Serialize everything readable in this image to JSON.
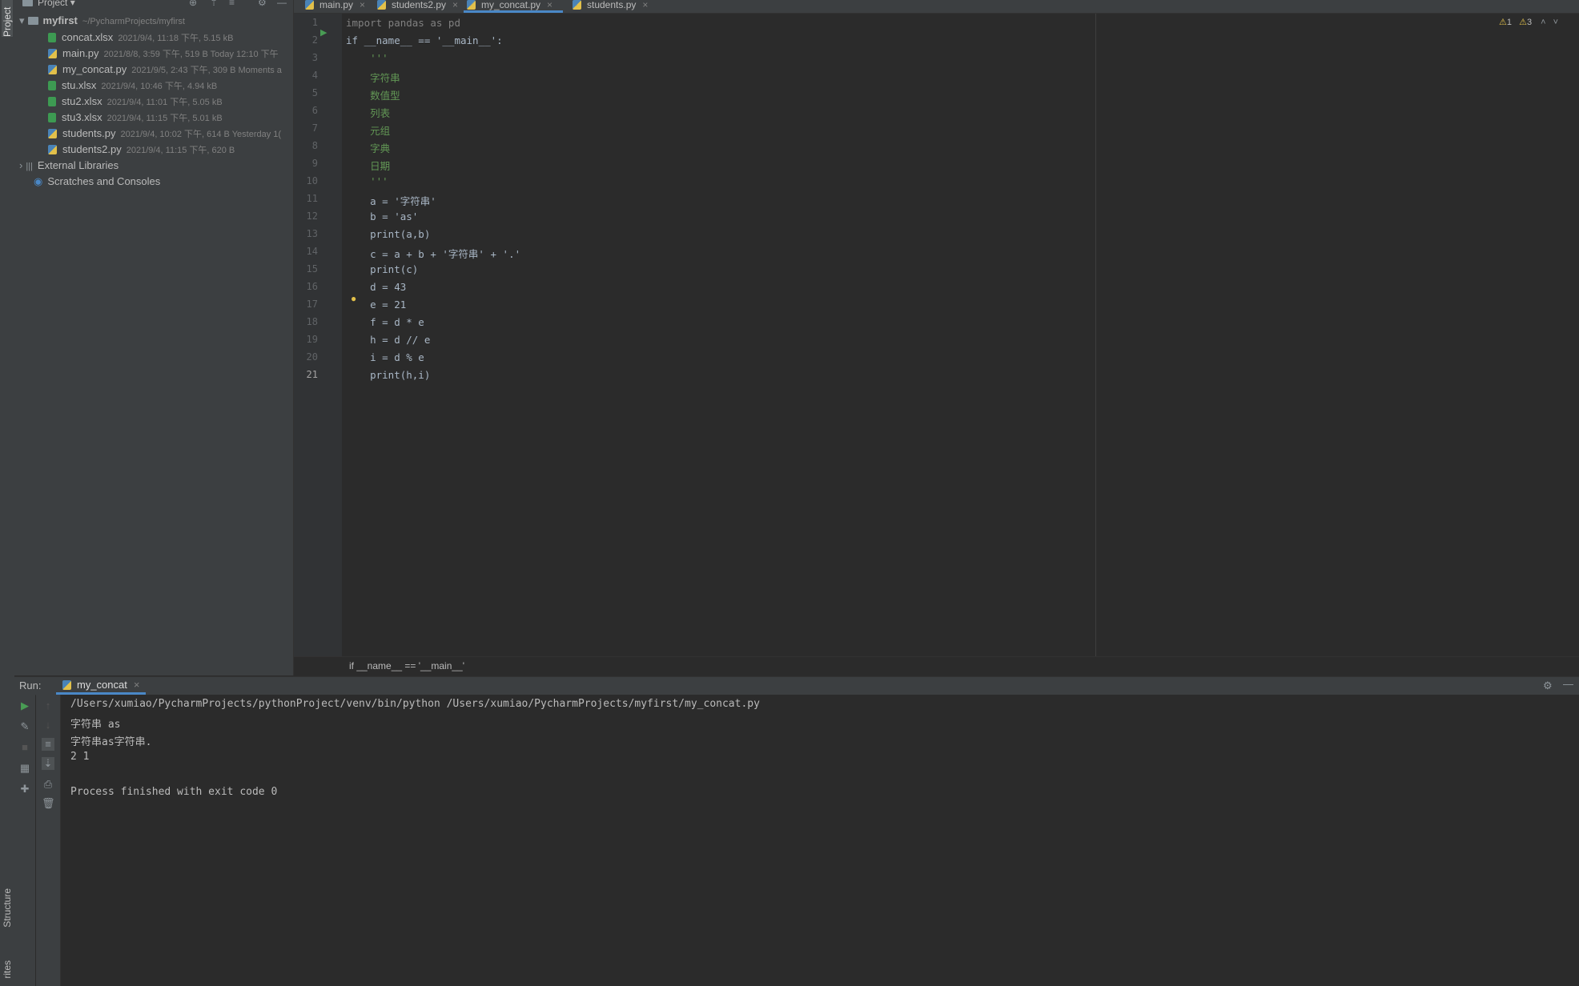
{
  "toolwindow": {
    "project_label": "Project",
    "structure_label": "Structure",
    "favorites_label": "rites"
  },
  "project": {
    "header_label": "Project",
    "root_name": "myfirst",
    "root_path": "~/PycharmProjects/myfirst",
    "files": [
      {
        "name": "concat.xlsx",
        "meta": "2021/9/4, 11:18 下午, 5.15 kB",
        "icon": "excel-file-icon"
      },
      {
        "name": "main.py",
        "meta": "2021/8/8, 3:59 下午, 519 B Today 12:10 下午",
        "icon": "python-file-icon"
      },
      {
        "name": "my_concat.py",
        "meta": "2021/9/5, 2:43 下午, 309 B Moments a",
        "icon": "python-file-icon"
      },
      {
        "name": "stu.xlsx",
        "meta": "2021/9/4, 10:46 下午, 4.94 kB",
        "icon": "excel-file-icon"
      },
      {
        "name": "stu2.xlsx",
        "meta": "2021/9/4, 11:01 下午, 5.05 kB",
        "icon": "excel-file-icon"
      },
      {
        "name": "stu3.xlsx",
        "meta": "2021/9/4, 11:15 下午, 5.01 kB",
        "icon": "excel-file-icon"
      },
      {
        "name": "students.py",
        "meta": "2021/9/4, 10:02 下午, 614 B Yesterday 1(",
        "icon": "python-file-icon"
      },
      {
        "name": "students2.py",
        "meta": "2021/9/4, 11:15 下午, 620 B",
        "icon": "python-file-icon"
      }
    ],
    "external_libraries": "External Libraries",
    "scratches": "Scratches and Consoles"
  },
  "tabs": [
    {
      "label": "main.py",
      "active": false
    },
    {
      "label": "students2.py",
      "active": false
    },
    {
      "label": "my_concat.py",
      "active": true
    },
    {
      "label": "students.py",
      "active": false
    }
  ],
  "inspections": {
    "warnings": "1",
    "weak_warnings": "3"
  },
  "editor": {
    "lines": [
      "import pandas as pd",
      "if __name__ == '__main__':",
      "    '''",
      "    字符串",
      "    数值型",
      "    列表",
      "    元组",
      "    字典",
      "    日期",
      "    '''",
      "    a = '字符串'",
      "    b = 'as'",
      "    print(a,b)",
      "    c = a + b + '字符串' + '.'",
      "    print(c)",
      "    d = 43",
      "    e = 21",
      "    f = d * e",
      "    h = d // e",
      "    i = d % e",
      "    print(h,i)"
    ],
    "line_numbers": [
      "1",
      "2",
      "3",
      "4",
      "5",
      "6",
      "7",
      "8",
      "9",
      "10",
      "11",
      "12",
      "13",
      "14",
      "15",
      "16",
      "17",
      "18",
      "19",
      "20",
      "21"
    ],
    "breadcrumb": "if __name__ == '__main__'"
  },
  "run": {
    "label": "Run:",
    "config_name": "my_concat",
    "output": [
      "/Users/xumiao/PycharmProjects/pythonProject/venv/bin/python /Users/xumiao/PycharmProjects/myfirst/my_concat.py",
      "字符串 as",
      "字符串as字符串.",
      "2 1",
      "",
      "Process finished with exit code 0"
    ]
  },
  "colors": {
    "editor_bg": "#2b2b2b",
    "panel_bg": "#3c3f41",
    "keyword": "#cc7832",
    "string": "#6a8759",
    "number": "#6897bb",
    "accent": "#4a88c7"
  }
}
